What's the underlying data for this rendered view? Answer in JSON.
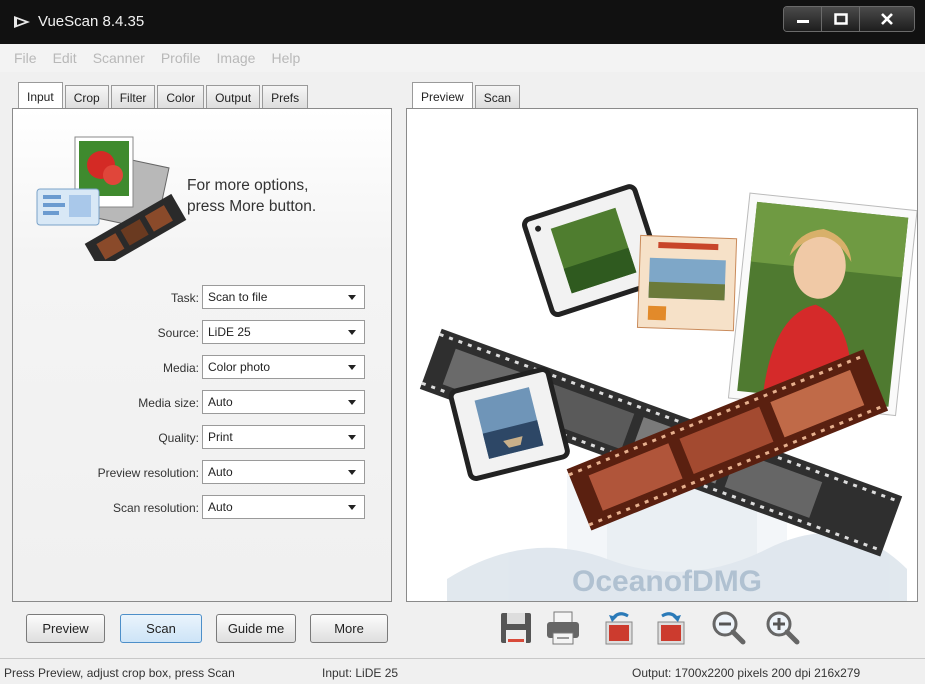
{
  "window": {
    "title": "VueScan 8.4.35"
  },
  "menu": [
    "File",
    "Edit",
    "Scanner",
    "Profile",
    "Image",
    "Help"
  ],
  "left_tabs": [
    "Input",
    "Crop",
    "Filter",
    "Color",
    "Output",
    "Prefs"
  ],
  "left_active_tab": "Input",
  "banner_text": {
    "line1": "For more options,",
    "line2": "press More button."
  },
  "form": {
    "task": {
      "label": "Task:",
      "value": "Scan to file"
    },
    "source": {
      "label": "Source:",
      "value": "LiDE 25"
    },
    "media": {
      "label": "Media:",
      "value": "Color photo"
    },
    "media_size": {
      "label": "Media size:",
      "value": "Auto"
    },
    "quality": {
      "label": "Quality:",
      "value": "Print"
    },
    "preview_resolution": {
      "label": "Preview resolution:",
      "value": "Auto"
    },
    "scan_resolution": {
      "label": "Scan resolution:",
      "value": "Auto"
    }
  },
  "right_tabs": [
    "Preview",
    "Scan"
  ],
  "right_active_tab": "Preview",
  "preview_watermark": "OceanofDMG",
  "buttons": {
    "preview": "Preview",
    "scan": "Scan",
    "guide": "Guide me",
    "more": "More"
  },
  "toolbar_icons": [
    "save-icon",
    "print-icon",
    "rotate-left-icon",
    "rotate-right-icon",
    "zoom-out-icon",
    "zoom-in-icon"
  ],
  "status": {
    "hint": "Press Preview, adjust crop box, press Scan",
    "input": "Input: LiDE 25",
    "output": "Output: 1700x2200 pixels 200 dpi 216x279"
  },
  "colors": {
    "titlebar": "#111111",
    "focus_button": "#cde4f7",
    "menu_disabled": "#b8b8b8"
  }
}
